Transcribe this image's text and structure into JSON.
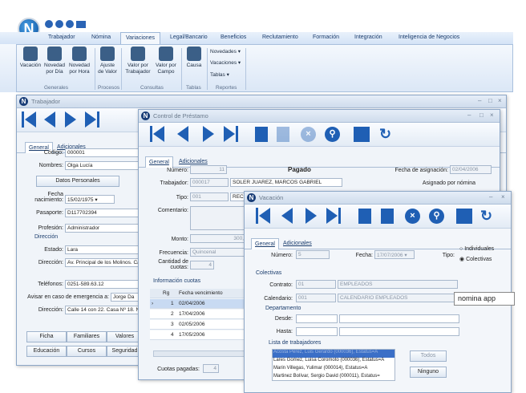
{
  "ribbon": {
    "tabs": [
      "Trabajador",
      "Nómina",
      "Variaciones",
      "Legal/Bancario",
      "Beneficios",
      "Reclutamiento",
      "Formación",
      "Integración",
      "Inteligencia de Negocios"
    ],
    "active_tab": "Variaciones",
    "buttons": [
      {
        "label": "Vacación",
        "icon": "person-run-icon"
      },
      {
        "label": "Novedad por Día",
        "icon": "calendar-icon"
      },
      {
        "label": "Novedad por Hora",
        "icon": "clock-icon"
      },
      {
        "label": "Ajuste de Valor",
        "icon": "document-edit-icon"
      },
      {
        "label": "Valor por Trabajador",
        "icon": "people-icon"
      },
      {
        "label": "Valor por Campo",
        "icon": "form-icon"
      },
      {
        "label": "Causa",
        "icon": "people-cause-icon"
      }
    ],
    "menus": [
      "Novedades",
      "Vacaciones",
      "Tablas"
    ],
    "groups": [
      "Generales",
      "Procesos",
      "Consultas",
      "Tablas",
      "Reportes"
    ]
  },
  "trabajador": {
    "title": "Trabajador",
    "tabs": [
      "General",
      "Adicionales"
    ],
    "codigo_label": "Código:",
    "codigo": "000001",
    "nombres_label": "Nombres:",
    "nombres": "Olga Lucía",
    "datos_tab": "Datos Personales",
    "fecha_label": "Fecha nacimiento:",
    "fecha": "15/02/1975",
    "pasaporte_label": "Pasaporte:",
    "pasaporte": "D117702394",
    "profesion_label": "Profesión:",
    "profesion": "Administrador",
    "direccion_section": "Dirección",
    "estado_label": "Estado:",
    "estado": "Lara",
    "direccion_label": "Dirección:",
    "direccion": "Av. Principal de los Molinos. Ca",
    "telefonos_label": "Teléfonos:",
    "telefonos": "0251-589.63.12",
    "avisar_label": "Avisar en caso de emergencia a:",
    "avisar": "Jorge Da",
    "direccion2_label": "Dirección:",
    "direccion2": "Calle 14 con 22. Casa Nº 18. N",
    "bottom_buttons": [
      "Ficha",
      "Familiares",
      "Valores",
      "Educación",
      "Cursos",
      "Seguridad"
    ]
  },
  "prestamo": {
    "title": "Control de Préstamo",
    "tabs": [
      "General",
      "Adicionales"
    ],
    "numero_label": "Número:",
    "numero": "11",
    "status": "Pagado",
    "fecha_asig_label": "Fecha de asignación:",
    "fecha_asig": "02/04/2006",
    "trabajador_label": "Trabajador:",
    "trabajador_code": "000017",
    "trabajador_name": "SOLER JUAREZ, MARCOS GABRIEL",
    "asignado_label": "Asignado por nómina",
    "tipo_label": "Tipo:",
    "tipo_code": "001",
    "tipo_name": "REC",
    "comentario_label": "Comentario:",
    "monto_label": "Monto:",
    "monto": "300,",
    "frecuencia_label": "Frecuencia:",
    "frecuencia": "Quincenal",
    "cantidad_label": "Cantidad de cuotas:",
    "cantidad": "4",
    "info_section": "Información cuotas",
    "grid_headers": [
      "Rg",
      "Fecha vencimiento"
    ],
    "grid_rows": [
      [
        "1",
        "02/04/2006"
      ],
      [
        "2",
        "17/04/2006"
      ],
      [
        "3",
        "02/05/2006"
      ],
      [
        "4",
        "17/05/2006"
      ]
    ],
    "cuotas_label": "Cuotas pagadas:",
    "cuotas": "4"
  },
  "vacacion": {
    "title": "Vacación",
    "tabs": [
      "General",
      "Adicionales"
    ],
    "numero_label": "Número:",
    "numero": "5",
    "fecha_label": "Fecha:",
    "fecha": "17/07/2006",
    "tipo_label": "Tipo:",
    "tipo_options": [
      "Individuales",
      "Colectivas"
    ],
    "tipo_selected": "Colectivas",
    "colectivas_section": "Colectivas",
    "contrato_label": "Contrato:",
    "contrato_code": "01",
    "contrato_name": "EMPLEADOS",
    "calendario_label": "Calendario:",
    "calendario_code": "001",
    "calendario_name": "CALENDARIO EMPLEADOS",
    "departamento_section": "Departamento",
    "desde_label": "Desde:",
    "hasta_label": "Hasta:",
    "lista_label": "Lista de trabajadores",
    "lista": [
      "Acosta Pérez, Luis Gerardo (000036), Estatus=A",
      "Lares Gomez, Luisa Coromoto (000036), Estatus=A",
      "Marin Villegas, Yulimar (000014), Estatus=A",
      "Martinez Bolívar, Sergio David (000011), Estatus="
    ],
    "todos_btn": "Todos",
    "ninguno_btn": "Ninguno"
  },
  "tooltip": "nomina app"
}
